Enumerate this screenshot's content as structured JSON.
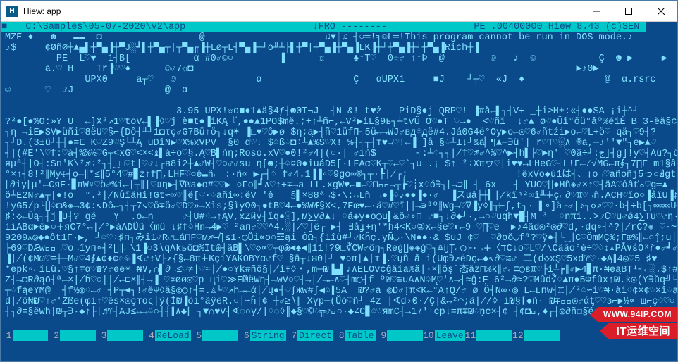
{
  "window": {
    "title": "Hiew: app",
    "icon_label": "H"
  },
  "status": {
    "prefix_marker": "■",
    "path": "C:\\Samples\\05-07-2020\\v2\\app",
    "mode": "↓FRO",
    "flags": "--------",
    "format": "PE",
    "base": ".00400000",
    "product": "Hiew 8.43 (c)SEN"
  },
  "hex": {
    "line01": "MZÉ ♦   ☻   ▬▬  ◘                 @                     ♫▼║♫ ┤○═!╕☺L═!This program cannot be run in DOS mode.♪",
    "line02": "♪$     ¢Øñ⌀┼▲▄▌┼▀▄▐┼▀J░┛▌┼▀▄┬|┬▀▄╓▐┼Lø┬L┤▀▄▐┼┘o╜┴├▌┼▀|┼▀▄▐┼▀▄▐LK▐┼┘┼▀▄▐┼┘┼▀▄▐Rich┼▐",
    "line03": "         PE  L♡♥  1┤B[           α #0♂☺○        ▐      ☼     ♣↑T♡  0☆♂ ↑↑Þ  @        ☺   ♪  ☺           Ç  ☻ ▶     ▶",
    "line04": "       a.♡ H    Tr▐♡♡♦      ☺♂7☼◘                                                                   ►♪0►           ",
    "line05": "              UPX0     a┬♡   ☺              α                Ç   αUPX1     ■J    ┘┬♡  «J  ♦              @  α.rsrc    '♡ ■",
    "line06": "☺      ♡  ♂J                @  α                                                                                        ",
    "line07": "",
    "line08": "                              3.95 UPX!☼o■●1▲ä§4ƒ┤☻0T¬J  ┤N &! t♥ż   PiD§●j QRP♡! ▐#å←▌┐┤V÷ _┼i>H±:«┤●●$A ¡i┼^┘",
    "line09": "?²●[●%O:»Y U  ←]X²↗1♡toV←▌▐◊♡j è■t●▐iKĄ『,●●▲1PO$më↓;+↑┴ñ⌐,←V²▶iL§9ь┐┴tvÜ O♡●T ♡→●  <♡ñi  ↓♂▲ ø♡●Üi°öü°âº%éiÉ B 3-ëä§¢°",
    "line10": "┐η →iE▶SV►üñi♡8ëU♡§⌐{Dô┤╨┘1◘τç♂G7Bü↑ö┐↓q☀ ▐∟♥♡ô▶ø $η;ą▶┤ñ♡1üfП┐5ü↔→WJ♂вд♧дё#4.Já0G4ё°Oy▶o←◎♡6♂ñtźi▶o←♡L+ö♡ qä┐♡9┤?",
    "line11": "┐┘D.(3±ü┘┼┤●=E K♡Z9♡Ş└┴Ą uDiN▶♡X%xVPV  §0 d♡↓ $♤ß♡◘÷┴▲%Ŝ♡X! %┤┐┬┤т♥→♡!←▐ ]å §♡┴⊥↓┘&ä▏¶▲─∋ü'| r♡T♡░∧ ®a,─♪''▼\"┐e▶▲♡",
    "line12": "┤|(#E'\\♡f:♡à┤%%½♡G┬<xG♡<×<♝▌á÷o♡§.Ą♡B▌ńη;Roso.xV♡●0!²♂4|(○∙∣ ♂iń$       ┤:┴♤┐┐∤f♡♐♂^%♡^▶┤h▌├♡►η' ♡0â÷┘:ج]┤g]!y♡┤Aü?┐ő?∥∤",
    "line13": "яμª┤|O┤:Sп'K\\²♐÷²┐┤‿□♡t|♡♂↓┌в8i2┼▲♂W┤♡○♂♂su η[☻;┼♤¤0●iuáD5[∙LFAα♡K┬♡←♡`┐∪ .¡ $↑ ²÷Xπヮ♡∣i♥♥↔LHeG♡┤L!Γ←∕√MG←π∮┐7∏Γ m1§âx²←♤",
    "line14": "°×↑┤8!²∥Mу☩┤o═∥*≤∥5°4♡#▊ź↑f∏,LHF♡○ě▬ñ← :∙ñ∝ ▶┌┤♤ f♂4↓1▐▐∘♡9go∞®┐┬∙┞∤┌;                   !êxVo◆ú1は┤、¡o→♡añoñj5っ○∄gt▾♡◯úä∄☺♂♡",
    "line15": "∥∂iy∥μ'←CяE∙▊πW♀♡ö♂%i←|┬∥|♡♊η▶┤∇₪a◆o#♡♡▶ ○Гo∥┛∧♡↑+∓→a LL.xgW♥←■←♡⊓▎⃝→┬┢♡┊x♢ó∋┐∥→⊃∥ ┤ 6x   ┤ YUO♡∐●Hñ◈♂×↑♡┤äA♡άâťه♡g═♟",
    "line16": "ö┴E2N♂▲┬|●!o  °.²∤NůïäHi!Gt∽∞♡║ë[♡∙♡añi∞:ëV 'ê   §▌×88ª→$∙\\:↔Lñ →●▐♤♪●●▐●∙♂  ▐スuâ├┼▎∤kïⁿ²∞î╨∔ç←∂♡♊♡→ñ.ACH♡ïо○▐ảïU▐♯%åş",
    "line17": "!yG5/p└∐♤◘&◈→3¢:↖Dô←┐┤┬7↘♡ö∓ö♂♡D♡»→Xìs;§ìyΩ0┐●tB♡4←●%WÆ§X<,7Eœ♥←∙ä♡#♡ï∣∥→∍³º∥Wg→♡∇▐y◊∥┬⊢∫,t┐∙ ▌∘]ä┌♂|♪┐◇↗♡♡·b┤÷b[┐∞∞∞U┤∤",
    "line18": "♯:◇←Ūą┐┤j▐∪┤? gé   Ỵ  .o←n     ♂┤Ụ#♢→↑ĄV,xZйỵ┤ǐq●░],м∑ỵ∂▲↓ ♢á◈y●o◯u▌&ö♂∘⊓ ♂■┐↓∂◆┘∙,→○♡uqh▼█┤M ³  ♢nπi..>♂∁♡ụ♂ǿ4∑Tụ♡♂η∙#@¥⌈ӌ♀♡●●♡ӌ▌♡>",
    "line19": "íiABα►ë▶○∔яC7°↔∤°▶áΛDÜũ〈mû ↓♯f♤Hn→4▶♡ ²aп♂♡♡^4.░∤♡]ë┌ ▶┤ ∃åɟ+η'*h4<K○②x←§e♡◐←9 ♡∏♡e  ▶♪4âd◎²◎∂♡d,∙dq∘┤^?∤rC?◈ ♡∙~ ♡≅Ω◎ ♒ ▊áđó▐┬",
    "line20": "9209ⲁ◎◆●ôt1Γ∙▶, ┘♤♡÷♯п┐みî1♂R♂∟á⊓F♡м♐―̸]≤1∙◯Ůi∝o○☲ąi−ÓΩ┐{1îü#┘♂Kĥç.yÑ◡∙\\N●●∙& $uJ ¢♡  ♡∂oŏ◡fª?♡ÿ●┤└‿∥C♡ÖmMÇ%;Γæ%∥←○ĵ;u∤├Tf",
    "line21": "├69♡DÆw♚⃝→♡o→ïyп∘┤²∐∥←\\1▐○3∖qΛkьô◘%Itǣ┤âB▌\\♡◇∝♡┬φǣ◄♠◄∥11!?9∟∛CW♂ôŋ┐Reǵ∐◈◈ǵ♡┐♎ĳŢ←◯├∙→∔〈דC↓o♡L♡/\\Cäão°ě÷♡♢↕▵ΡẰ∨έOˣř●♂┛♂○┤○",
    "line22": "▐∤(¢Mω♡=┼─M♂♡4∮▲¢♦¢♘♧▐∢♂↑V├↗{§←8π∔KçiYΑKOBYα♂f♡ §ä┬↓∺0|┘⌐♥○π|▲∣т▐.♡ųñ å i(Uφ∋↗ëDç←◆↖∂♡≋♂ 二(d◇xŞ♡5xd♈♡∙◆Ą∥4◎♡5 ♯♥",
    "line23": "*epk∘←iLù.♡§↑∓α♡☎?♂өe☀ ₦∨,∩▌∂→≤♡≠∣♡≈∤●○Ỵk#ñö§∤iŦ◊・,m─₪▐▄▌♪∧ELOvcĝăiā%ă∣∙×∥öş`态äz⊓%k∥♂←⊏◯ε♊♡├i╧┢∥♂▶4▊π∙₦ẹąBŢ¹┤←░.$↑#♢◊☰k≤←◇け%",
    "line24": "Z┤→◘R∂ąō┤ª←×∤ĥ♡○|∤←⊏×∥┤→▐ ♡∝øø◎♡p цi♡≫E₪ิëWη┤→wV○♡┤→∤→←∧♡┤m◯┤f º₪♡≌∪A∧N♤M̨♡'∧→┤≈ĝ:Ẹ 6²→∂≈?♡Mûd∛♢▲π●5Φfûх↑₪.k◎(Y∋ůq╝└∂ ь∋м0♋п└",
    "line25": "┬♡fąeYM@  ┤f½◎♢←♂ ┤P┬◄┐!♂ëΨ◊ä§◎◯↑┤=.♙└♡↗h→←ά∤ų●┤♡∫жw#∫◀♤∥5Α  ₪?♂a ◎D♂Ţπ<K←°A↑Q/♂ ø Ö┤N∞∙◎ L←ւпw┤♊∤²♤∽i♡₦·ài♢¢×¢♡×î♡ạ",
    "line26": "d∤ö₦₪♡↑♂'Zße(φi↑♡ës×◎çтος│ÿ(İ₪▐öi°âÿëR.○│∽‭ĥ|¢ ┼♂≥∖∥ Хγp─(Ŭȯ♡ñ┘ 4z ∣∢d›0·/Ç|&↔²◠;ä∤/◊ i₪§⌈◆ñ∙ ₪∓♡⃝◎♂άƫ♡♡з⌐▶½∝ щ⌐ç♢♡○₅∢∫∵",
    "line27": "┤┐∂=§ëWh|₪┬∋∙◆↑├|♬♈┤ΑJ≤↔→♤○┤┤∥∧◆∥ ┐▼∩♥V┤∢◌○у/|♢◌◊║◆§♡©♡╦♂⃝○∙◆∠C▊♤♡яmC┤→17'+cp↓=π∓₪♡ņс×┤¢ ┤¢◘⃝,♦┌┤◎∂ñ☐§̑é♢◈∔≤▌з|♢∨┤○―¡ø§?←┤"
  },
  "fkeys": {
    "f1": "",
    "f2": "",
    "f3": "",
    "f4": "ReLoad",
    "f5": "",
    "f6": "String",
    "f7": "Direct",
    "f8": "Table",
    "f9": "",
    "f10": "Leave",
    "f11": "",
    "f12": ""
  },
  "watermark": {
    "url": "WWW.94IP.COM",
    "label": "IT运维空间"
  }
}
